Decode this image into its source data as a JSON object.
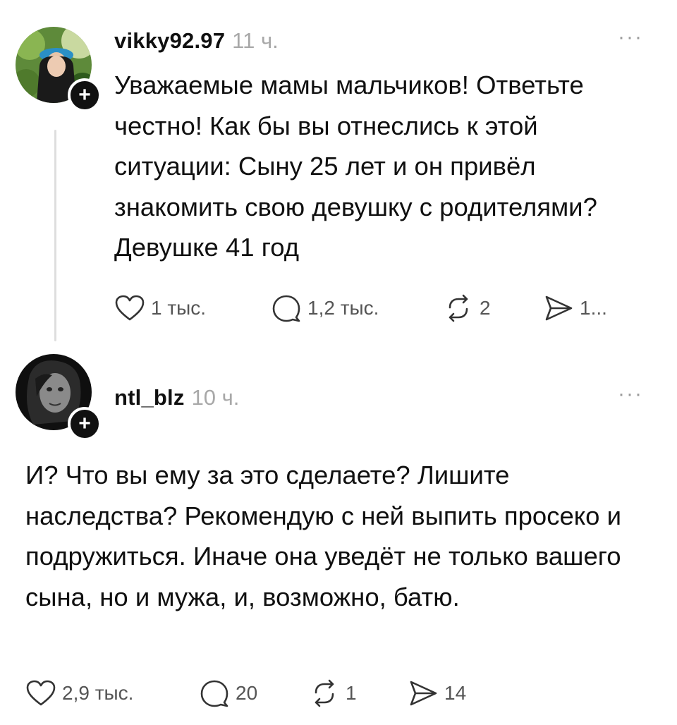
{
  "posts": [
    {
      "username": "vikky92.97",
      "time": "11 ч.",
      "text": "Уважаемые мамы мальчиков! Ответьте честно! Как бы вы отнеслись к этой ситуации: Сыну 25 лет и он привёл знакомить свою девушку с родителями? Девушке 41 год",
      "likes": "1 тыс.",
      "replies": "1,2 тыс.",
      "reposts": "2",
      "shares": "1..."
    },
    {
      "username": "ntl_blz",
      "time": "10 ч.",
      "text": "И? Что вы ему за это сделаете? Лишите наследства? Рекомендую с ней выпить просеко и подружиться. Иначе она уведёт не только вашего сына, но и мужа, и, возможно, батю.",
      "likes": "2,9 тыс.",
      "replies": "20",
      "reposts": "1",
      "shares": "14"
    }
  ],
  "follow_symbol": "+",
  "more_symbol": "···",
  "icons": {
    "like": "heart-icon",
    "reply": "comment-icon",
    "repost": "repost-icon",
    "share": "send-icon",
    "more": "more-dots-icon",
    "follow": "plus-icon"
  },
  "colors": {
    "text": "#101010",
    "muted": "#a8a8a8",
    "action": "#555555",
    "thread_line": "#dedede"
  }
}
